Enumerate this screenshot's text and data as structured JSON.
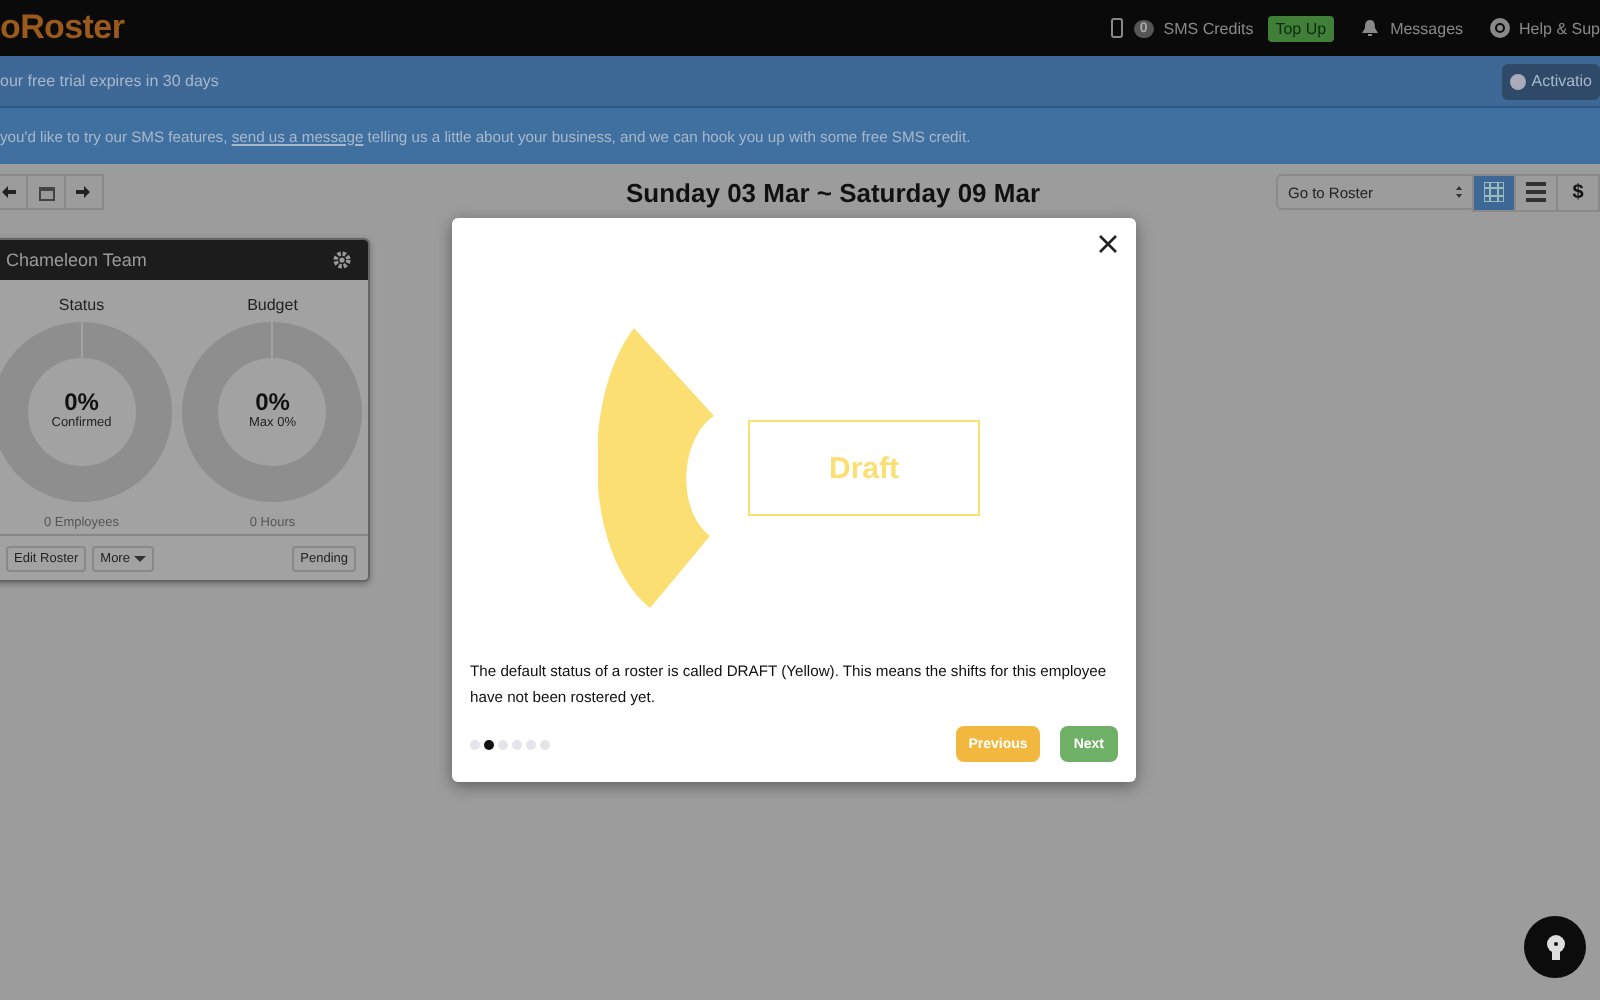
{
  "header": {
    "logo": "oRoster",
    "sms_count": "0",
    "sms_label": "SMS Credits",
    "top_up": "Top Up",
    "messages": "Messages",
    "help": "Help & Sup"
  },
  "trial_banner": {
    "text": "our free trial expires in 30 days",
    "button": "Activatio"
  },
  "sms_banner": {
    "before": "you'd like to try our SMS features, ",
    "link": "send us a message",
    "after": " telling us a little about your business, and we can hook you up with some free SMS credit."
  },
  "toolbar": {
    "date_range": "Sunday 03 Mar ~ Saturday 09 Mar",
    "goto": "Go to Roster",
    "views": [
      {
        "kind": "grid",
        "selected": true
      },
      {
        "kind": "list",
        "selected": false
      },
      {
        "kind": "dollar",
        "label": "$",
        "selected": false
      }
    ]
  },
  "team_card": {
    "title": "Chameleon Team",
    "gauges": [
      {
        "title": "Status",
        "value": "0%",
        "sub": "Confirmed",
        "footer": "0 Employees",
        "level": 0
      },
      {
        "title": "Budget",
        "value": "0%",
        "sub": "Max 0%",
        "footer": "0 Hours",
        "level": 0
      }
    ],
    "buttons": [
      "Edit Roster",
      "More"
    ],
    "status": "Pending"
  },
  "modal": {
    "illustration_label": "Draft",
    "text": "The default status of a roster is called DRAFT (Yellow). This means the shifts for this employee have not been rostered yet.",
    "steps": [
      {
        "selected": false
      },
      {
        "selected": true
      },
      {
        "selected": false
      },
      {
        "selected": false
      },
      {
        "selected": false
      },
      {
        "selected": false
      }
    ],
    "previous": "Previous",
    "next": "Next"
  }
}
